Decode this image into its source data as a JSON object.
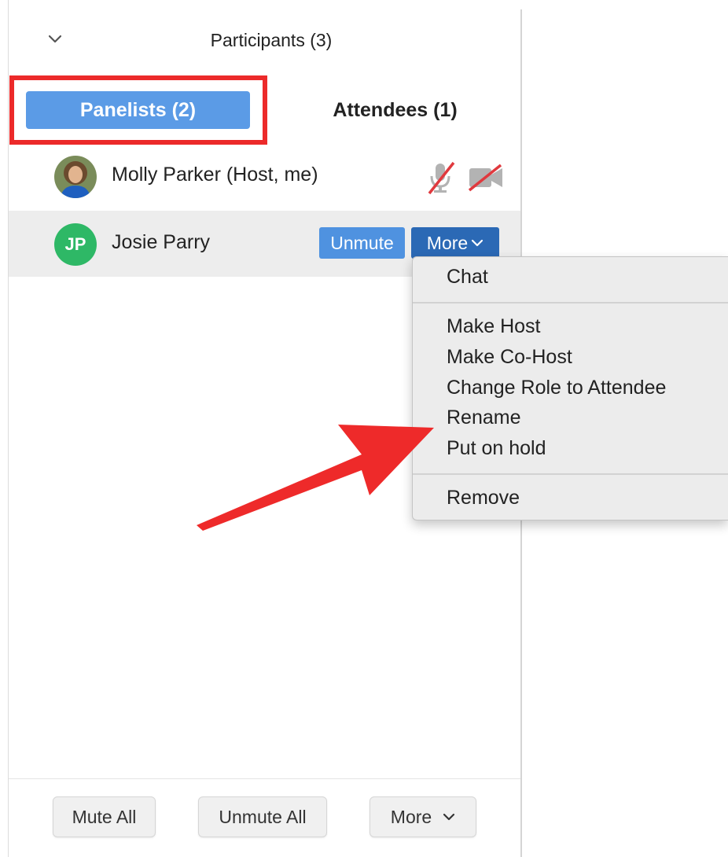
{
  "header": {
    "title": "Participants (3)"
  },
  "tabs": {
    "panelists": "Panelists (2)",
    "attendees": "Attendees (1)"
  },
  "participants": [
    {
      "name": "Molly Parker (Host, me)",
      "avatar": "photo"
    },
    {
      "name": "Josie Parry",
      "initials": "JP",
      "avatar_color": "#2eb866"
    }
  ],
  "row_actions": {
    "unmute": "Unmute",
    "more": "More"
  },
  "context_menu": {
    "items": [
      "Chat",
      "Make Host",
      "Make Co-Host",
      "Change Role to Attendee",
      "Rename",
      "Put on hold",
      "Remove"
    ]
  },
  "footer": {
    "mute_all": "Mute All",
    "unmute_all": "Unmute All",
    "more": "More"
  },
  "colors": {
    "accent_tab": "#5b9be6",
    "unmute_button": "#4f92e0",
    "more_button": "#2b69b5",
    "highlight_red": "#ec2a2a",
    "avatar_green": "#2eb866"
  },
  "icons": [
    "chevron-down-icon",
    "muted-microphone-icon",
    "video-off-icon",
    "annotation-arrow"
  ]
}
